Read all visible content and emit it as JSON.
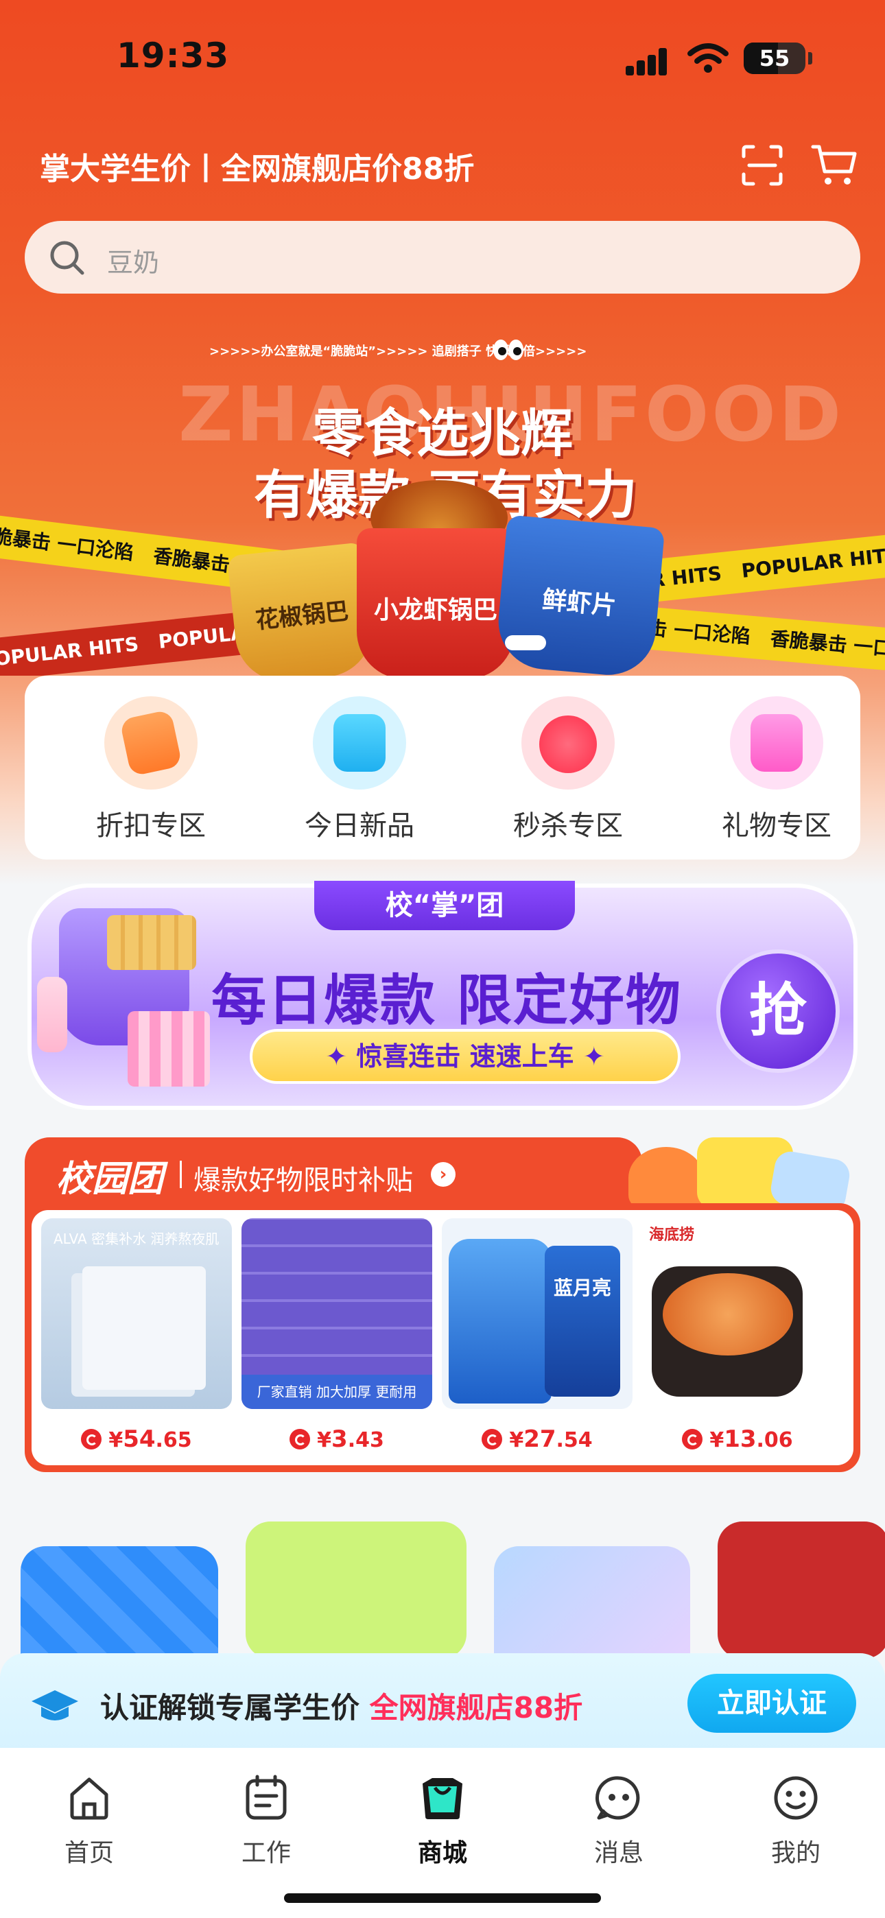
{
  "status": {
    "time": "19:33",
    "battery": "55"
  },
  "header": {
    "title": "掌大学生价丨全网旗舰店价88折"
  },
  "search": {
    "placeholder": "豆奶"
  },
  "banner": {
    "top_line": ">>>>>办公室就是“脆脆站”>>>>> 追剧搭子 快乐加倍>>>>>",
    "bg_text": "ZHAOHUIFOOD",
    "headline1": "零食选兆辉",
    "headline2": "有爆款 更有实力",
    "tape_cn": "香脆暴击 一口沦陷",
    "tape_en": "POPULAR HITS",
    "product1": "花椒锅巴",
    "product2": "小龙虾锅巴",
    "product3": "鲜虾片"
  },
  "categories": [
    {
      "label": "折扣专区",
      "icon": "discount-icon",
      "color": "#ff8a3c"
    },
    {
      "label": "今日新品",
      "icon": "new-tag-icon",
      "color": "#27c3f5"
    },
    {
      "label": "秒杀专区",
      "icon": "stopwatch-icon",
      "color": "#ff3d5a"
    },
    {
      "label": "礼物专区",
      "icon": "gift-icon",
      "color": "#ff6fd0"
    }
  ],
  "team_banner": {
    "tab": "校“掌”团",
    "headline": "每日爆款 限定好物",
    "sub": "✦ 惊喜连击 速速上车 ✦",
    "button": "抢"
  },
  "campus": {
    "brand": "校园团",
    "tagline": "爆款好物限时补贴",
    "products": [
      {
        "name": "ALVA 密集补水 润养熬夜肌",
        "price_symbol": "¥",
        "price_int": "54",
        "price_dec": ".65",
        "color": "#c9dcf0"
      },
      {
        "name": "厂家直销 加大加厚 更耐用",
        "price_symbol": "¥",
        "price_int": "3",
        "price_dec": ".43",
        "color": "#7a67d6"
      },
      {
        "name": "蓝月亮",
        "price_symbol": "¥",
        "price_int": "27",
        "price_dec": ".54",
        "color": "#2d79d8"
      },
      {
        "name": "海底捞",
        "price_symbol": "¥",
        "price_int": "13",
        "price_dec": ".06",
        "color": "#3a2a24"
      }
    ]
  },
  "verify": {
    "text": "认证解锁专属学生价",
    "highlight": "全网旗舰店88折",
    "button": "立即认证"
  },
  "tabs": [
    {
      "label": "首页",
      "icon": "home-icon",
      "active": false
    },
    {
      "label": "工作",
      "icon": "clipboard-icon",
      "active": false
    },
    {
      "label": "商城",
      "icon": "shopping-bag-icon",
      "active": true
    },
    {
      "label": "消息",
      "icon": "message-icon",
      "active": false
    },
    {
      "label": "我的",
      "icon": "smile-icon",
      "active": false
    }
  ],
  "colors": {
    "accent": "#ee4a22",
    "price": "#e8262a",
    "verify_button": "#10a8f0"
  }
}
